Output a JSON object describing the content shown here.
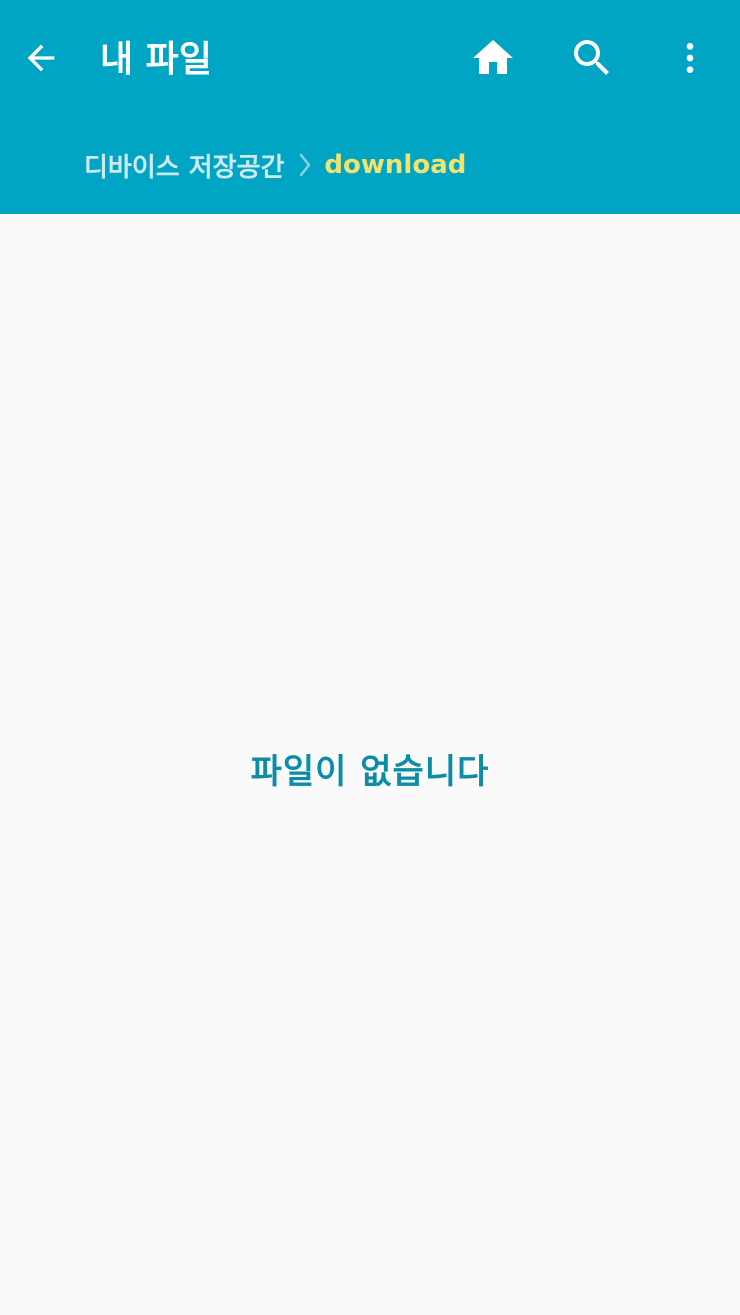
{
  "colors": {
    "appbar": "#00a5c4",
    "background": "#fafafa",
    "title_text": "#ffffff",
    "breadcrumb_root": "#cde9f1",
    "breadcrumb_current": "#f3e36c",
    "empty_message": "#0d8ca6"
  },
  "toolbar": {
    "title": "내 파일",
    "icons": {
      "back": "arrow-back-icon",
      "home": "home-icon",
      "search": "search-icon",
      "more": "more-vertical-icon"
    }
  },
  "breadcrumb": {
    "root": "디바이스 저장공간",
    "separator_icon": "chevron-right-icon",
    "current": "download"
  },
  "content": {
    "empty_message": "파일이 없습니다"
  }
}
